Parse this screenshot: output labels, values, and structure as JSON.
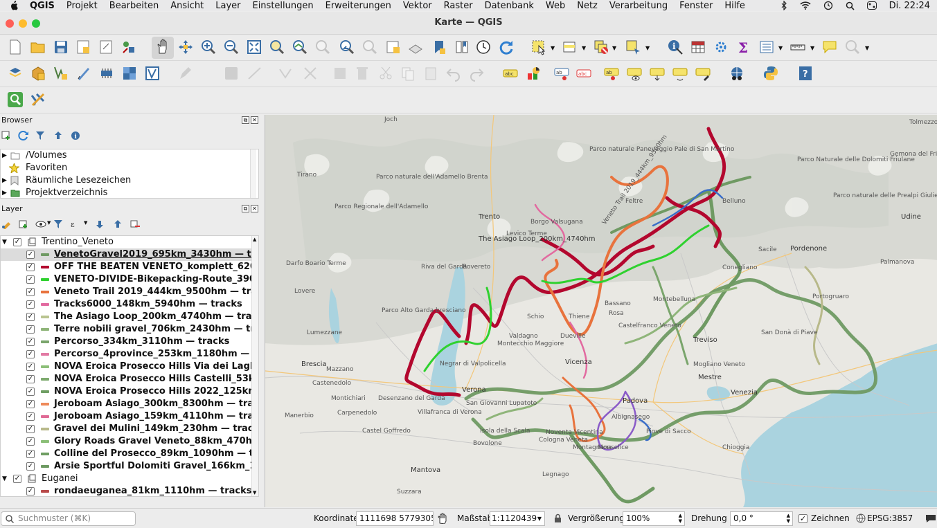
{
  "menubar": {
    "app": "QGIS",
    "items": [
      "Projekt",
      "Bearbeiten",
      "Ansicht",
      "Layer",
      "Einstellungen",
      "Erweiterungen",
      "Vektor",
      "Raster",
      "Datenbank",
      "Web",
      "Netz",
      "Verarbeitung",
      "Fenster",
      "Hilfe"
    ],
    "clock": "Di. 22:24"
  },
  "window": {
    "title": "Karte — QGIS"
  },
  "browser": {
    "title": "Browser",
    "items": [
      "/Volumes",
      "Favoriten",
      "Räumliche Lesezeichen",
      "Projektverzeichnis"
    ]
  },
  "layers": {
    "title": "Layer",
    "rows": [
      {
        "type": "group",
        "label": "Trentino_Veneto"
      },
      {
        "type": "layer",
        "label": "VenetoGravel2019_695km_3430hm — tracks",
        "color": "#6f9a63",
        "selected": true
      },
      {
        "type": "layer",
        "label": "OFF THE BEATEN VENETO_komplett_620km",
        "color": "#b3072e"
      },
      {
        "type": "layer",
        "label": "VENETO-DIVIDE-Bikepacking-Route_390km",
        "color": "#2fd12f"
      },
      {
        "type": "layer",
        "label": "Veneto Trail 2019_444km_9500hm — tracks",
        "color": "#e8733d"
      },
      {
        "type": "layer",
        "label": "Tracks6000_148km_5940hm — tracks",
        "color": "#e26aa0"
      },
      {
        "type": "layer",
        "label": "The Asiago Loop_200km_4740hm — tracks",
        "color": "#b9c490"
      },
      {
        "type": "layer",
        "label": "Terre nobili gravel_706km_2430hm — tracks",
        "color": "#8fb57a"
      },
      {
        "type": "layer",
        "label": "Percorso_334km_3110hm — tracks",
        "color": "#7aa56c"
      },
      {
        "type": "layer",
        "label": "Percorso_4province_253km_1180hm — tracks",
        "color": "#e27aa4"
      },
      {
        "type": "layer",
        "label": "NOVA Eroica Prosecco Hills Via dei Laghi_12",
        "color": "#8cbf78"
      },
      {
        "type": "layer",
        "label": "NOVA Eroica Prosecco Hills Castelli_53km_",
        "color": "#7daa6e"
      },
      {
        "type": "layer",
        "label": "NOVA Eroica Prosecco Hills 2022_125km_23",
        "color": "#6f9e63"
      },
      {
        "type": "layer",
        "label": "Jeroboam Asiago_300km_8300hm — tracks",
        "color": "#ee8a5a"
      },
      {
        "type": "layer",
        "label": "Jeroboam Asiago_159km_4110hm — tracks",
        "color": "#e06a95"
      },
      {
        "type": "layer",
        "label": "Gravel dei Mulini_149km_230hm — tracks",
        "color": "#b8b98a"
      },
      {
        "type": "layer",
        "label": "Glory Roads Gravel Veneto_88km_470hm —",
        "color": "#8bbf77"
      },
      {
        "type": "layer",
        "label": "Colline del Prosecco_89km_1090hm — tracks",
        "color": "#6f9e63"
      },
      {
        "type": "layer",
        "label": "Arsie Sportful Dolomiti Gravel_166km_1870",
        "color": "#6e9a62"
      },
      {
        "type": "group",
        "label": "Euganei"
      },
      {
        "type": "layer",
        "label": "rondaeuganea_81km_1110hm — tracks",
        "color": "#b84a4a"
      }
    ]
  },
  "status": {
    "search_placeholder": "Suchmuster (⌘K)",
    "coord_label": "Koordinate",
    "coord_value": "1111698  5779305",
    "scale_label": "Maßstab",
    "scale_value": "1:1120439",
    "magnify_label": "Vergrößerung",
    "magnify_value": "100%",
    "rotation_label": "Drehung",
    "rotation_value": "0,0 °",
    "render_label": "Zeichnen",
    "crs": "EPSG:3857"
  },
  "map": {
    "labels": [
      "Joch",
      "Tirano",
      "Parco naturale dell'Adamello Brenta",
      "Parco Regionale dell'Adamello",
      "Trento",
      "Levico Terme",
      "Borgo Valsugana",
      "The Asiago Loop_200km_4740hm",
      "Veneto Trail 2019_444km_9500hm",
      "Rovereto",
      "Riva del Garda",
      "Darfo Boario Terme",
      "Lovere",
      "Lumezzane",
      "Parco Alto Garda bresciano",
      "Brescia",
      "Schio",
      "Thiene",
      "Valdagno",
      "Dueville",
      "Montecchio Maggiore",
      "Vicenza",
      "Negrar di Valpolicella",
      "Verona",
      "Desenzano del Garda",
      "San Giovanni Lupatoto",
      "Villafranca di Verona",
      "Castenedolo",
      "Mazzano",
      "Manerbio",
      "Carpenedolo",
      "Montichiari",
      "Castel Goffredo",
      "Isola della Scala",
      "Bovolone",
      "Cologna Veneta",
      "Noventa Vicentina",
      "Montagnana",
      "Mantova",
      "Suzzara",
      "Legnago",
      "Padova",
      "Albignasego",
      "Piove di Sacco",
      "Monselice",
      "Chioggia",
      "Mestre",
      "Venezia",
      "Mogliano Veneto",
      "Treviso",
      "Castelfranco Veneto",
      "Montebelluna",
      "Bassano",
      "Rosa",
      "Conegliano",
      "Pordenone",
      "Sacile",
      "San Donà di Piave",
      "Portogruaro",
      "Palmanova",
      "Udine",
      "Belluno",
      "Feltre",
      "Parco naturale Paneveggio Pale di San Martino",
      "Parco Naturale delle Dolomiti Friulane",
      "Gemona del Friuli",
      "Parco naturale delle Prealpi Giulie",
      "Tolmezzo",
      "Chiampo",
      "Campodarsego",
      "Piombino Dese",
      "Spinea",
      "Scorzè",
      "Oderzo",
      "Vittorio Veneto",
      "Valdobbiadene",
      "San Vito al Tagliamento",
      "Latisana",
      "Caorle",
      "Jesolo",
      "Campagna Lupia",
      "Adria",
      "Rovigo",
      "Badia Polesine",
      "Ostiglia",
      "Lendinara",
      "Vigonza",
      "Cittadella",
      "Marostica",
      "Asolo",
      "Trevignano",
      "Arco",
      "Nago",
      "Malcesine",
      "Bardolino",
      "Lazise",
      "Sirmione",
      "Peschiera",
      "Valeggio",
      "Roverè",
      "Bosco Chiesanuova",
      "Tregnago",
      "Arzignano",
      "Lonigo",
      "Este",
      "Rovolon",
      "Teolo",
      "Abano Terme",
      "Cadoneghe",
      "Noale",
      "Mirano",
      "Dolo",
      "Stra",
      "Camponogara",
      "Codevigo",
      "Cavarzere",
      "Loreo",
      "Porto Viro",
      "Taglio di Po",
      "Ariano",
      "Mesola",
      "Goro",
      "Codigoro",
      "Comacchio",
      "Lagosanto",
      "Massa Fiscaglia",
      "Copparo",
      "Ferrara",
      "Bondeno",
      "Poggio Rusco",
      "Sermide",
      "Castelmassa",
      "Ficarolo",
      "Occhiobello",
      "Polesella",
      "Crespino",
      "Villadose",
      "Ceregnano",
      "Pettorazza",
      "Agna",
      "Conselve",
      "Cartura",
      "Pernumia",
      "Battaglia",
      "Galzignano",
      "Torreglia",
      "Selvazzano",
      "Veggiano",
      "Mestrino",
      "Rubano",
      "Saccolongo",
      "Cervarese",
      "Montegalda",
      "Grisignano",
      "Camisano",
      "Torri di Quartesolo",
      "Quinto",
      "Bolzano Vicentino",
      "Sandrigo",
      "Breganze",
      "Bassano del Grappa",
      "Romano",
      "Mussolente",
      "Possagno",
      "Cavaso",
      "Pederobba",
      "Segusino",
      "Quero",
      "Alano",
      "Fener",
      "Vas",
      "Lentiai",
      "Mel",
      "Trichiana",
      "Limana",
      "Ponte nelle Alpi",
      "Longarone",
      "Pieve di Cadore",
      "Auronzo",
      "Santo Stefano",
      "Sappada",
      "Forni",
      "Ampezzo",
      "Villa Santina",
      "Paluzza",
      "Ovaro",
      "Comeglians",
      "Rigolato",
      "Prato Carnico",
      "Sauris",
      "Vigo",
      "Lorenzago",
      "Domegge",
      "Calalzo",
      "Perarolo",
      "Ospitale",
      "Cortina",
      "San Vito",
      "Borca",
      "Vodo",
      "Zoppè",
      "Forno",
      "Alleghe",
      "Rocca",
      "Livinallongo",
      "Arabba",
      "Canazei",
      "Moena",
      "Predazzo",
      "Cavalese",
      "Tesero",
      "Ziano",
      "Panchià",
      "Castello",
      "Bellamonte",
      "San Martino",
      "Fiera di Primiero",
      "Imer",
      "Mezzano",
      "Transacqua",
      "Canal San Bovo",
      "Lamon",
      "Sovramonte",
      "Arsiè",
      "Fonzaso",
      "Seren",
      "Cesiomaggiore",
      "Santa Giustina",
      "Sedico",
      "Sospirolo"
    ]
  }
}
